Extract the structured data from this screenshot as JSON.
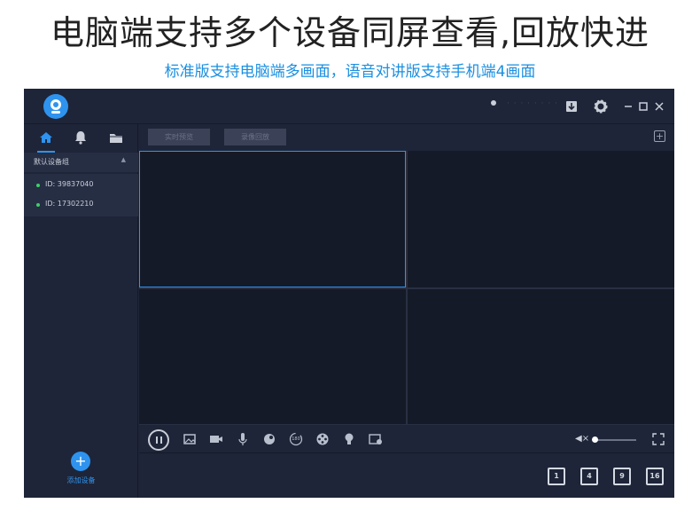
{
  "banner": {
    "headline": "电脑端支持多个设备同屏查看,回放快进",
    "subline": "标准版支持电脑端多画面，语音对讲版支持手机端4画面"
  },
  "titlebar": {
    "user_name": "· · · · · · · ·",
    "icons": [
      "download-icon",
      "gear-icon",
      "minimize-icon",
      "maximize-icon",
      "close-icon"
    ]
  },
  "sidebar": {
    "tabs": [
      {
        "name": "home-icon",
        "active": true
      },
      {
        "name": "bell-icon",
        "active": false
      },
      {
        "name": "folder-icon",
        "active": false
      }
    ],
    "group": {
      "label": "默认设备组",
      "caret": "▲"
    },
    "devices": [
      {
        "label": "ID: 39837040",
        "status_color": "#3ecf6a"
      },
      {
        "label": "ID: 17302210",
        "status_color": "#3ecf6a"
      }
    ],
    "add_device": {
      "icon": "+",
      "label": "添加设备"
    }
  },
  "main": {
    "tabs": [
      {
        "label": "实时预览"
      },
      {
        "label": "录像回放"
      }
    ],
    "add_window_icon": "+"
  },
  "toolbar": {
    "tools": [
      "image-icon",
      "video-camera-icon",
      "microphone-icon",
      "ptz-icon",
      "rotate-180-icon",
      "film-reel-icon",
      "bulb-icon",
      "picture-settings-icon"
    ],
    "rotate_label": "180",
    "volume": {
      "muted": true,
      "level": 0.0,
      "icon": "◀×"
    }
  },
  "layouts": [
    {
      "label": "1",
      "name": "layout-1-button"
    },
    {
      "label": "4",
      "name": "layout-4-button"
    },
    {
      "label": "9",
      "name": "layout-9-button"
    },
    {
      "label": "16",
      "name": "layout-16-button"
    }
  ],
  "colors": {
    "accent": "#2e93ee",
    "online": "#3ecf6a",
    "background": "#1e2538",
    "video": "#151a28"
  }
}
